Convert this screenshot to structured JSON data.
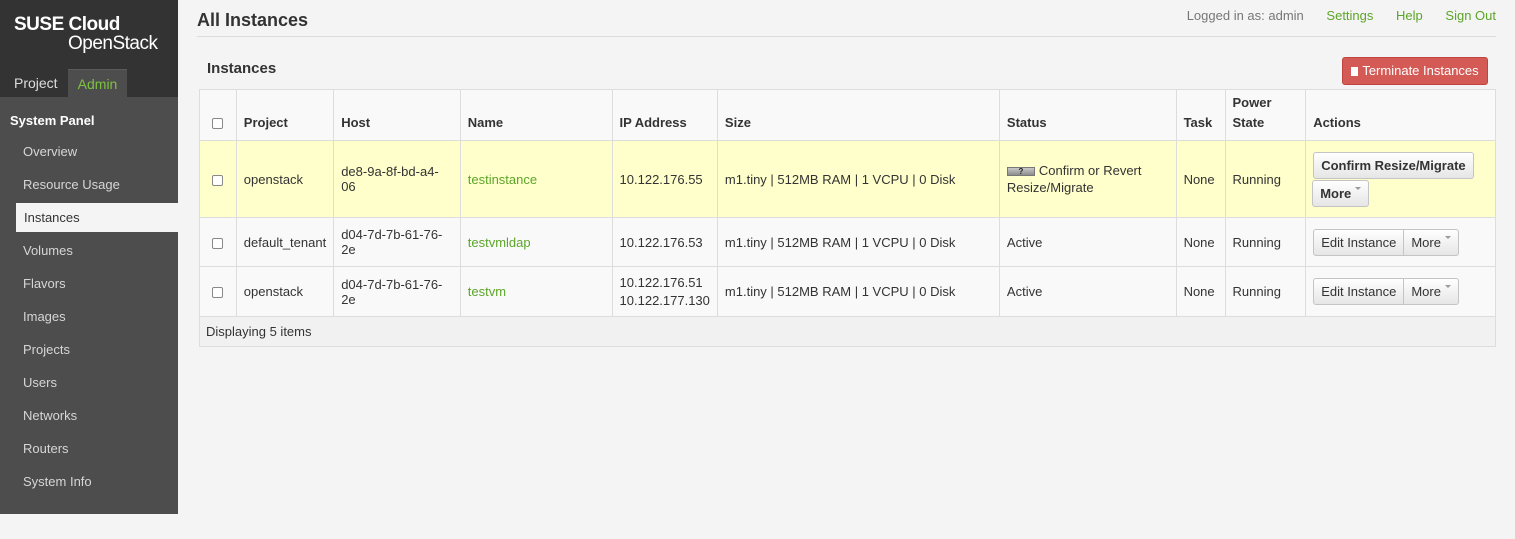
{
  "brand": {
    "line1": "SUSE Cloud",
    "line2": "OpenStack"
  },
  "dashboard_tabs": {
    "project": "Project",
    "admin": "Admin"
  },
  "sidebar": {
    "panel_title": "System Panel",
    "items": [
      "Overview",
      "Resource Usage",
      "Instances",
      "Volumes",
      "Flavors",
      "Images",
      "Projects",
      "Users",
      "Networks",
      "Routers",
      "System Info"
    ],
    "active": "Instances"
  },
  "header": {
    "page_title": "All Instances",
    "logged_in": "Logged in as: admin",
    "settings": "Settings",
    "help": "Help",
    "sign_out": "Sign Out"
  },
  "table": {
    "title": "Instances",
    "terminate_label": "Terminate Instances",
    "columns": [
      "Project",
      "Host",
      "Name",
      "IP Address",
      "Size",
      "Status",
      "Task",
      "Power State",
      "Actions"
    ],
    "power_state_header": [
      "Power",
      "State"
    ],
    "rows": [
      {
        "project": "openstack",
        "host": "de8-9a-8f-bd-a4-06",
        "name": "testinstance",
        "ip": [
          "10.122.176.55"
        ],
        "size": "m1.tiny | 512MB RAM | 1 VCPU | 0 Disk",
        "status": "Confirm or Revert Resize/Migrate",
        "task": "None",
        "power_state": "Running",
        "primary_action": "Confirm Resize/Migrate",
        "more": "More"
      },
      {
        "project": "default_tenant",
        "host": "d04-7d-7b-61-76-2e",
        "name": "testvmldap",
        "ip": [
          "10.122.176.53"
        ],
        "size": "m1.tiny | 512MB RAM | 1 VCPU | 0 Disk",
        "status": "Active",
        "task": "None",
        "power_state": "Running",
        "primary_action": "Edit Instance",
        "more": "More"
      },
      {
        "project": "openstack",
        "host": "d04-7d-7b-61-76-2e",
        "name": "testvm",
        "ip": [
          "10.122.176.51",
          "10.122.177.130"
        ],
        "size": "m1.tiny | 512MB RAM | 1 VCPU | 0 Disk",
        "status": "Active",
        "task": "None",
        "power_state": "Running",
        "primary_action": "Edit Instance",
        "more": "More"
      }
    ],
    "footer": "Displaying 5 items"
  },
  "colors": {
    "accent": "#5da529",
    "danger": "#d45a56",
    "highlight_row": "#ffffcc",
    "sidebar_bg": "#4d4d4d"
  }
}
